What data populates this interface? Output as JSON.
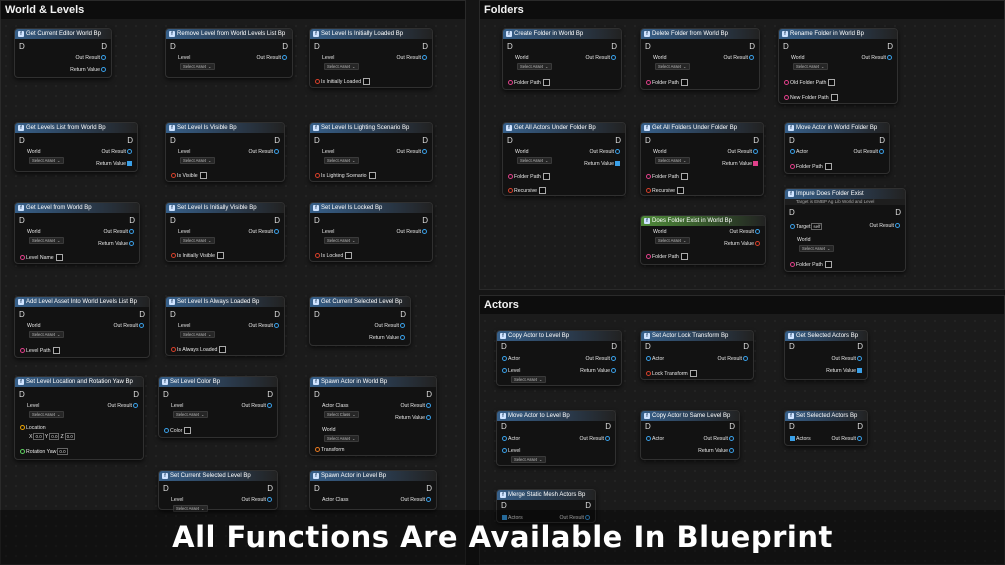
{
  "banner": "All Functions Are Available In Blueprint",
  "panels": {
    "world_levels": "World & Levels",
    "folders": "Folders",
    "actors": "Actors"
  },
  "common": {
    "out_result": "Out Result",
    "return_value": "Return Value",
    "world": "World",
    "level": "Level",
    "select_asset": "Select Asset",
    "select_class": "Select Class",
    "actor": "Actor",
    "exec": "D",
    "fn": "f"
  },
  "nodes": {
    "n1": "Get Current Editor World Bp",
    "n2": "Remove Level from World Levels List Bp",
    "n3": "Set Level Is Initially Loaded Bp",
    "n3_pin": "Is Initially Loaded",
    "n4": "Get Levels List from World Bp",
    "n5": "Set Level Is Visible Bp",
    "n5_pin": "Is Visible",
    "n6": "Set Level Is Lighting Scenario Bp",
    "n6_pin": "Is Lighting Scenario",
    "n7": "Get Level from World Bp",
    "n7_pin": "Level Name",
    "n8": "Set Level Is Initially Visible Bp",
    "n8_pin": "Is Initially Visible",
    "n9": "Set Level Is Locked Bp",
    "n9_pin": "Is Locked",
    "n10": "Add Level Asset Into World Levels List Bp",
    "n10_pin": "Level Path",
    "n11": "Set Level Is Always Loaded Bp",
    "n11_pin": "Is Always Loaded",
    "n12": "Get Current Selected Level Bp",
    "n13": "Set Level Location and Rotation Yaw Bp",
    "n13_loc": "Location",
    "n13_rot": "Rotation Yaw",
    "n13_x": "0.0",
    "n13_y": "0.0",
    "n13_z": "0.0",
    "n13_yawval": "0.0",
    "x": "X",
    "y": "Y",
    "z": "Z",
    "n14": "Set Level Color Bp",
    "n14_pin": "Color",
    "n15": "Spawn Actor in World Bp",
    "actor_class": "Actor Class",
    "transform": "Transform",
    "n16": "Set Current Selected Level Bp",
    "n17": "Spawn Actor in Level Bp",
    "f1": "Create Folder in World Bp",
    "folder_path": "Folder Path",
    "f2": "Delete Folder from World Bp",
    "f3": "Rename Folder in World Bp",
    "old_folder": "Old Folder Path",
    "new_folder": "New Folder Path",
    "f4": "Get All Actors Under Folder Bp",
    "recursive": "Recursive",
    "f5": "Get All Folders Under Folder Bp",
    "f6": "Move Actor in World Folder Bp",
    "f7": "Impure Does Folder Exist",
    "f7_sub": "Target is EMBP Ag Lib World and Level",
    "target": "Target",
    "self": "self",
    "f8": "Does Folder Exist in World Bp",
    "a1": "Copy Actor to Level Bp",
    "a2": "Set Actor Lock Transform Bp",
    "lock_transform": "Lock Transform",
    "a3": "Get Selected Actors Bp",
    "a4": "Move Actor to Level Bp",
    "a5": "Copy Actor to Same Level Bp",
    "a6": "Set Selected Actors Bp",
    "actors": "Actors",
    "a7": "Merge Static Mesh Actors Bp"
  }
}
